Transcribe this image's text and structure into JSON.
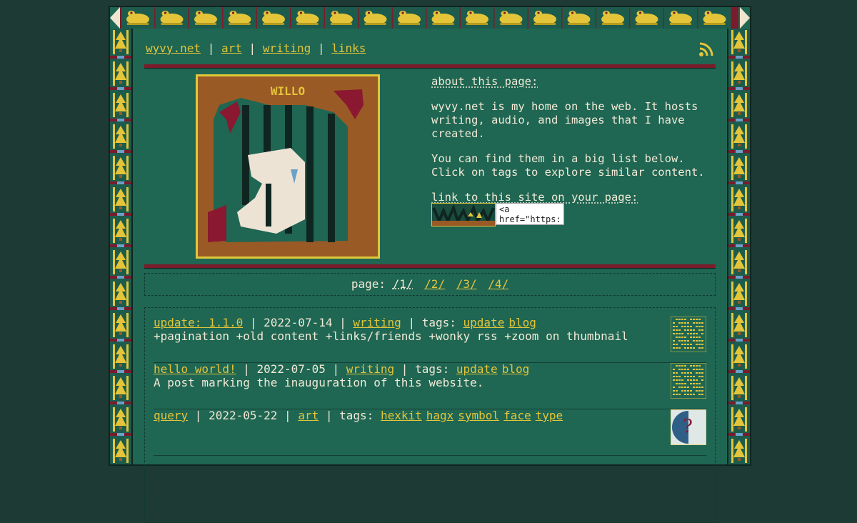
{
  "nav": {
    "home": "wyvy.net",
    "art": "art",
    "writing": "writing",
    "links": "links",
    "sep": "|"
  },
  "hero": {
    "title": "WILLO",
    "about_heading": "about this page:",
    "about_p1": "wyvy.net is my home on the web. It hosts writing, audio, and images that I have created.",
    "about_p2": "You can find them in a big list below. Click on tags to explore similar content.",
    "link_heading": "link to this site on your page:",
    "code_snippet": "<a href=\"https:"
  },
  "pager": {
    "label": "page:",
    "current": "/1/",
    "pages": [
      "/2/",
      "/3/",
      "/4/"
    ]
  },
  "posts": [
    {
      "title": "update: 1.1.0",
      "date": "2022-07-14",
      "category": "writing",
      "tags_label": "tags:",
      "tags": [
        "update",
        "blog"
      ],
      "description": "+pagination +old content +links/friends +wonky rss +zoom on thumbnail"
    },
    {
      "title": "hello world!",
      "date": "2022-07-05",
      "category": "writing",
      "tags_label": "tags:",
      "tags": [
        "update",
        "blog"
      ],
      "description": "A post marking the inauguration of this website."
    },
    {
      "title": "query",
      "date": "2022-05-22",
      "category": "art",
      "tags_label": "tags:",
      "tags": [
        "hexkit",
        "hagx",
        "symbol",
        "face",
        "type"
      ],
      "description": ""
    }
  ],
  "icons": {
    "rss": "rss-icon",
    "frog": "frog-icon"
  },
  "colors": {
    "background": "#1e3a34",
    "panel": "#1f6653",
    "link": "#e4c53a",
    "accent_rule": "#7a1c2b",
    "text": "#f1ead6"
  }
}
